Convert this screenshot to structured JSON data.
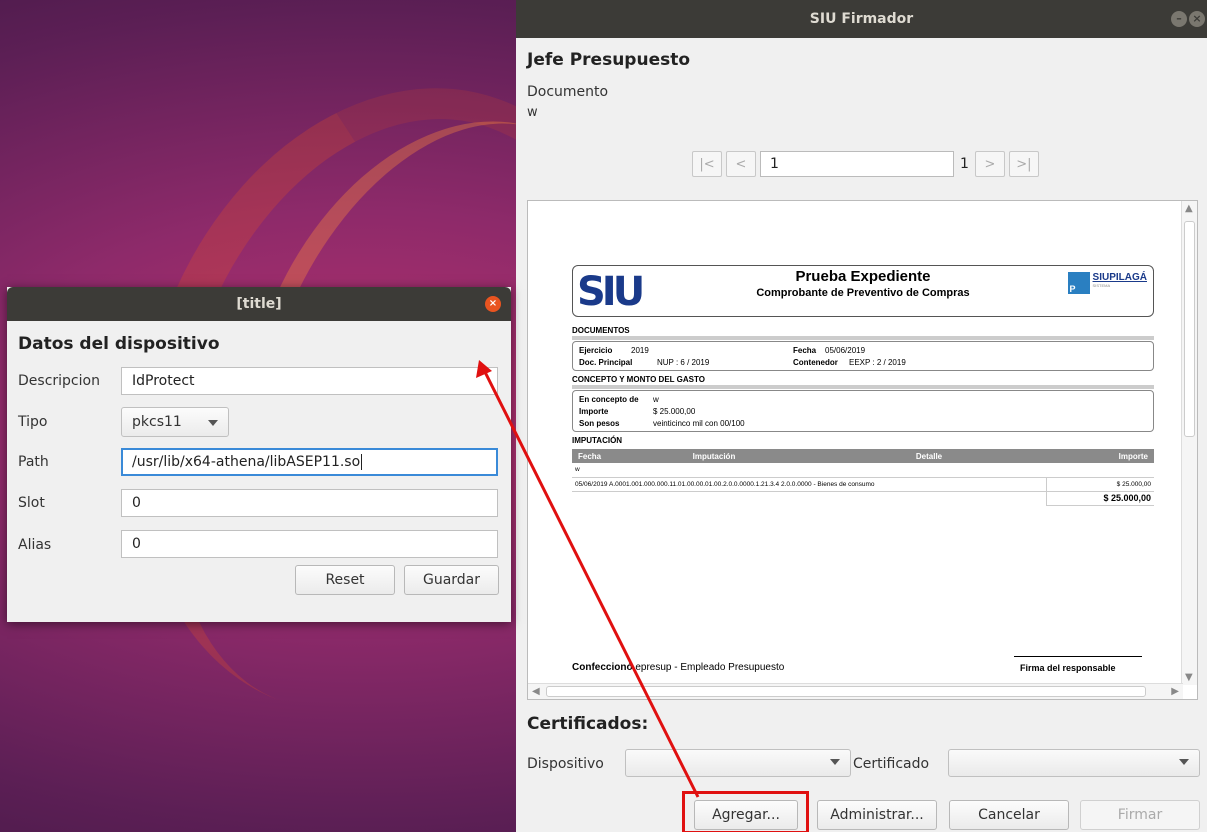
{
  "main_window": {
    "title": "SIU Firmador",
    "heading": "Jefe Presupuesto",
    "document_label": "Documento",
    "document_value": "w",
    "pager": {
      "first": "|<",
      "prev": "<",
      "current_page": "1",
      "total_pages": "1",
      "next": ">",
      "last": ">|"
    },
    "pdf": {
      "logo_text": "SIU",
      "title": "Prueba Expediente",
      "subtitle": "Comprobante de Preventivo de Compras",
      "brand": "SIUPILAGÁ",
      "sections": {
        "documentos": "DOCUMENTOS",
        "concepto": "CONCEPTO Y MONTO DEL GASTO",
        "imputacion": "IMPUTACIÓN"
      },
      "documentos": {
        "ejercicio_label": "Ejercicio",
        "ejercicio_value": "2019",
        "fecha_label": "Fecha",
        "fecha_value": "05/06/2019",
        "doc_principal_label": "Doc. Principal",
        "doc_principal_value": "NUP : 6 / 2019",
        "contenedor_label": "Contenedor",
        "contenedor_value": "EEXP : 2 / 2019"
      },
      "concepto": {
        "en_concepto_label": "En concepto de",
        "en_concepto_value": "w",
        "importe_label": "Importe",
        "importe_value": "$ 25.000,00",
        "son_pesos_label": "Son pesos",
        "son_pesos_value": "veinticinco mil con 00/100"
      },
      "imputacion_table": {
        "headers": [
          "Fecha",
          "Imputación",
          "Detalle",
          "Importe"
        ],
        "note": "w",
        "row": {
          "fecha": "05/06/2019",
          "imputacion": "A.0001.001.000.000.11.01.00.00.01.00.2.0.0.0000.1.21.3.4",
          "detalle": "2.0.0.0000 - Bienes de consumo",
          "importe": "$ 25.000,00"
        },
        "total": "$ 25.000,00"
      },
      "confecciono_label": "Confeccionó",
      "confecciono_value": "epresup - Empleado Presupuesto",
      "firma": "Firma del responsable"
    },
    "certificados_title": "Certificados:",
    "dispositivo_label": "Dispositivo",
    "certificado_label": "Certificado",
    "buttons": {
      "agregar": "Agregar...",
      "administrar": "Administrar...",
      "cancelar": "Cancelar",
      "firmar": "Firmar"
    }
  },
  "dialog": {
    "title": "[title]",
    "heading": "Datos del dispositivo",
    "fields": {
      "descripcion_label": "Descripcion",
      "descripcion_value": "IdProtect",
      "tipo_label": "Tipo",
      "tipo_value": "pkcs11",
      "path_label": "Path",
      "path_value": "/usr/lib/x64-athena/libASEP11.so",
      "slot_label": "Slot",
      "slot_value": "0",
      "alias_label": "Alias",
      "alias_value": "0"
    },
    "buttons": {
      "reset": "Reset",
      "guardar": "Guardar"
    }
  },
  "colors": {
    "titlebar": "#3c3b37",
    "close_button": "#e95420",
    "annotation": "#e01010",
    "focus": "#3a8ad8"
  }
}
